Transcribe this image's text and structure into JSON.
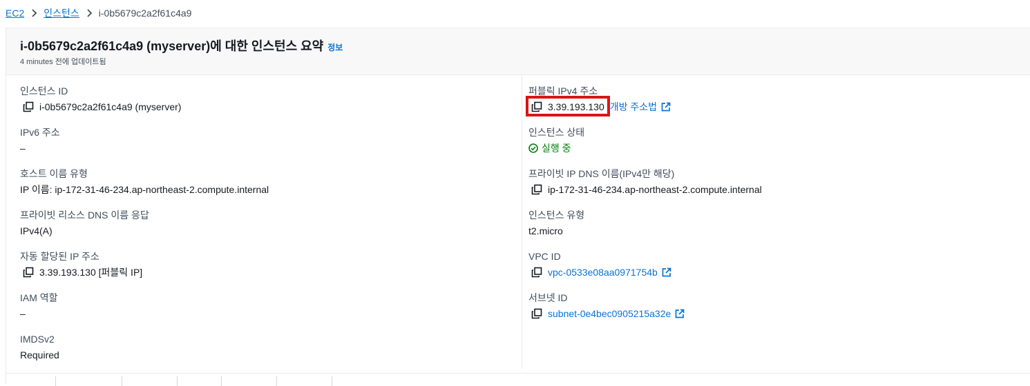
{
  "breadcrumb": {
    "ec2": "EC2",
    "instances": "인스턴스",
    "current": "i-0b5679c2a2f61c4a9"
  },
  "header": {
    "title": "i-0b5679c2a2f61c4a9 (myserver)에 대한 인스턴스 요약",
    "info": "정보",
    "updated": "4 minutes 전에 업데이트됨"
  },
  "left": {
    "instance_id": {
      "label": "인스턴스 ID",
      "value": "i-0b5679c2a2f61c4a9 (myserver)"
    },
    "ipv6": {
      "label": "IPv6 주소",
      "value": "–"
    },
    "hostname_type": {
      "label": "호스트 이름 유형",
      "value": "IP 이름: ip-172-31-46-234.ap-northeast-2.compute.internal"
    },
    "private_dns": {
      "label": "프라이빗 리소스 DNS 이름 응답",
      "value": "IPv4(A)"
    },
    "auto_ip": {
      "label": "자동 할당된 IP 주소",
      "value": "3.39.193.130 [퍼블릭 IP]"
    },
    "iam_role": {
      "label": "IAM 역할",
      "value": "–"
    },
    "imdsv2": {
      "label": "IMDSv2",
      "value": "Required"
    }
  },
  "right": {
    "public_ipv4": {
      "label": "퍼블릭 IPv4 주소",
      "value": "3.39.193.130",
      "link": "개방 주소법"
    },
    "state": {
      "label": "인스턴스 상태",
      "value": "실행 중"
    },
    "private_ip_dns": {
      "label": "프라이빗 IP DNS 이름(IPv4만 해당)",
      "value": "ip-172-31-46-234.ap-northeast-2.compute.internal"
    },
    "instance_type": {
      "label": "인스턴스 유형",
      "value": "t2.micro"
    },
    "vpc_id": {
      "label": "VPC ID",
      "value": "vpc-0533e08aa0971754b"
    },
    "subnet_id": {
      "label": "서브넷 ID",
      "value": "subnet-0e4bec0905215a32e"
    }
  },
  "colors": {
    "link": "#0972d3",
    "success": "#037f0c",
    "highlight": "#d91515"
  },
  "icons": [
    "chevron-right-icon",
    "copy-icon",
    "external-link-icon",
    "status-success-icon"
  ]
}
